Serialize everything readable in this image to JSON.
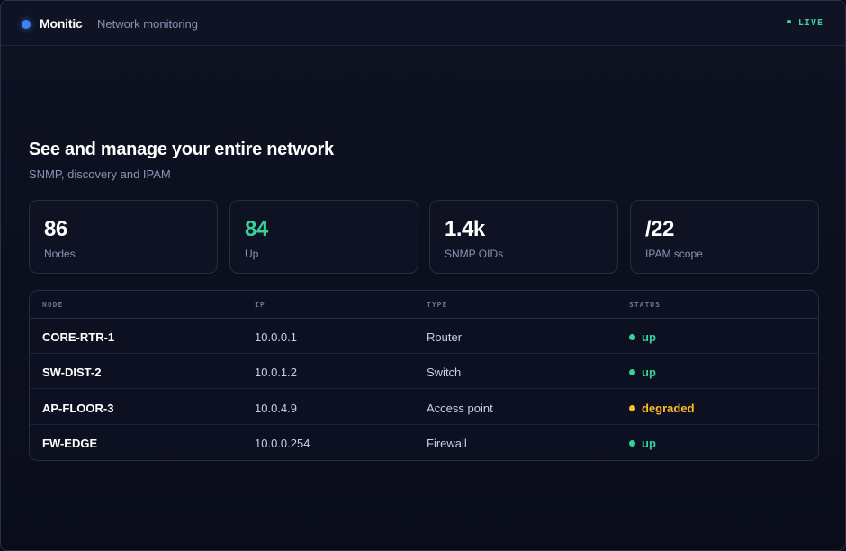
{
  "header": {
    "brand": "Monitic",
    "tagline": "Network monitoring",
    "live_label": "LIVE",
    "colors": {
      "brand_dot": "#3b82f6",
      "live": "#34d399"
    }
  },
  "hero": {
    "title": "See and manage your entire network",
    "subtitle": "SNMP, discovery and IPAM"
  },
  "stats": [
    {
      "value": "86",
      "label": "Nodes"
    },
    {
      "value": "84",
      "label": "Up",
      "color": "#34d399"
    },
    {
      "value": "1.4k",
      "label": "SNMP OIDs"
    },
    {
      "value": "/22",
      "label": "IPAM scope"
    }
  ],
  "table": {
    "columns": [
      "NODE",
      "IP",
      "TYPE",
      "STATUS"
    ],
    "rows": [
      {
        "node": "CORE-RTR-1",
        "ip": "10.0.0.1",
        "type": "Router",
        "status": "up"
      },
      {
        "node": "SW-DIST-2",
        "ip": "10.0.1.2",
        "type": "Switch",
        "status": "up"
      },
      {
        "node": "AP-FLOOR-3",
        "ip": "10.0.4.9",
        "type": "Access point",
        "status": "degraded"
      },
      {
        "node": "FW-EDGE",
        "ip": "10.0.0.254",
        "type": "Firewall",
        "status": "up"
      }
    ],
    "status_colors": {
      "up": "#34d399",
      "degraded": "#fbbf24"
    }
  }
}
